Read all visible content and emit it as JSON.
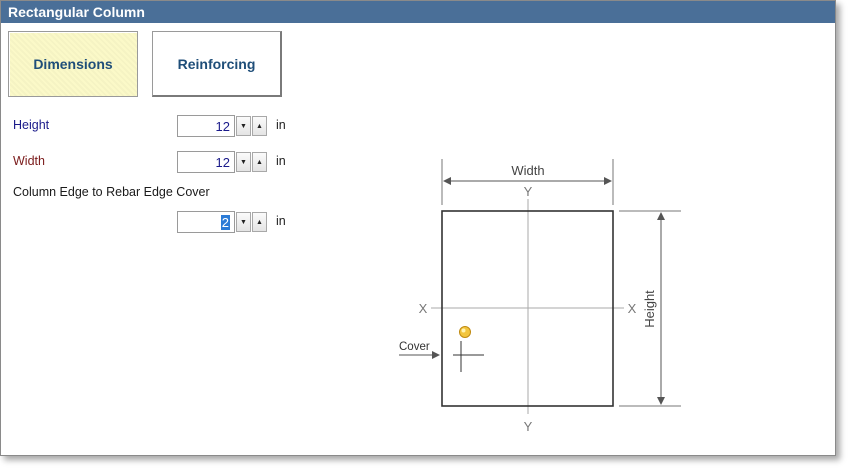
{
  "window": {
    "title": "Rectangular Column"
  },
  "tabs": [
    {
      "label": "Dimensions",
      "active": true
    },
    {
      "label": "Reinforcing",
      "active": false
    }
  ],
  "fields": {
    "height": {
      "label": "Height",
      "value": "12",
      "unit": "in",
      "label_color": "#1a1a8a"
    },
    "width": {
      "label": "Width",
      "value": "12",
      "unit": "in",
      "label_color": "#7a1a1a"
    },
    "cover": {
      "label": "Column Edge to Rebar Edge Cover",
      "value": "2",
      "unit": "in"
    }
  },
  "diagram": {
    "width_label": "Width",
    "height_label": "Height",
    "cover_label": "Cover",
    "axis_x": "X",
    "axis_y": "Y"
  },
  "icons": {
    "down": "spin-down-icon",
    "up": "spin-up-icon"
  },
  "colors": {
    "titlebar": "#4a6f98",
    "active_tab": "#fbf9c8",
    "tab_text": "#1f4e79"
  }
}
